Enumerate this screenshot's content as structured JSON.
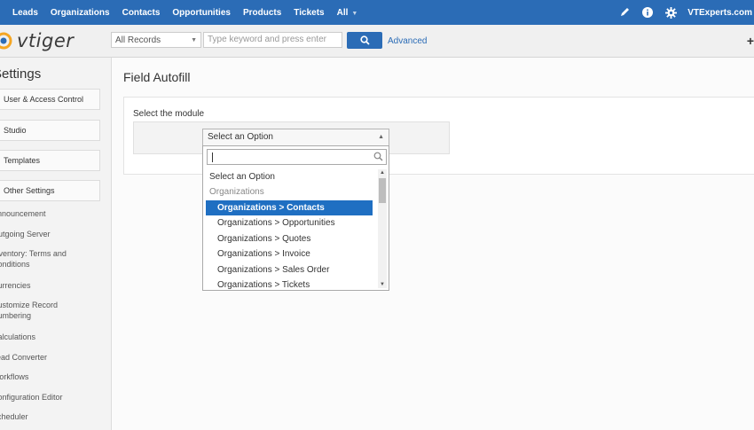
{
  "topnav": {
    "menu": [
      "Leads",
      "Organizations",
      "Contacts",
      "Opportunities",
      "Products",
      "Tickets",
      "All"
    ],
    "user": "VTExperts.com",
    "icons": [
      "pencil-icon",
      "info-icon",
      "gear-icon"
    ]
  },
  "header": {
    "logo": "vtiger",
    "records_select": "All Records",
    "search_placeholder": "Type keyword and press enter",
    "advanced": "Advanced",
    "plus": "+"
  },
  "sidebar": {
    "title": "Settings",
    "sections": [
      "User & Access Control",
      "Studio",
      "Templates",
      "Other Settings"
    ],
    "other_items": [
      "Announcement",
      "Outgoing Server",
      "Inventory: Terms and Conditions",
      "Currencies",
      "Customize Record Numbering",
      "Calculations",
      "Lead Converter",
      "Workflows",
      "Configuration Editor",
      "Scheduler"
    ]
  },
  "main": {
    "title": "Field Autofill",
    "module_label": "Select the module",
    "select_value": "Select an Option",
    "options": [
      {
        "label": "Select an Option",
        "kind": "option"
      },
      {
        "label": "Organizations",
        "kind": "group"
      },
      {
        "label": "Organizations > Contacts",
        "kind": "option",
        "highlighted": true
      },
      {
        "label": "Organizations > Opportunities",
        "kind": "option"
      },
      {
        "label": "Organizations > Quotes",
        "kind": "option"
      },
      {
        "label": "Organizations > Invoice",
        "kind": "option"
      },
      {
        "label": "Organizations > Sales Order",
        "kind": "option"
      },
      {
        "label": "Organizations > Tickets",
        "kind": "option"
      }
    ]
  },
  "colors": {
    "brand": "#2b6cb6",
    "highlight": "#1f6fc2"
  }
}
